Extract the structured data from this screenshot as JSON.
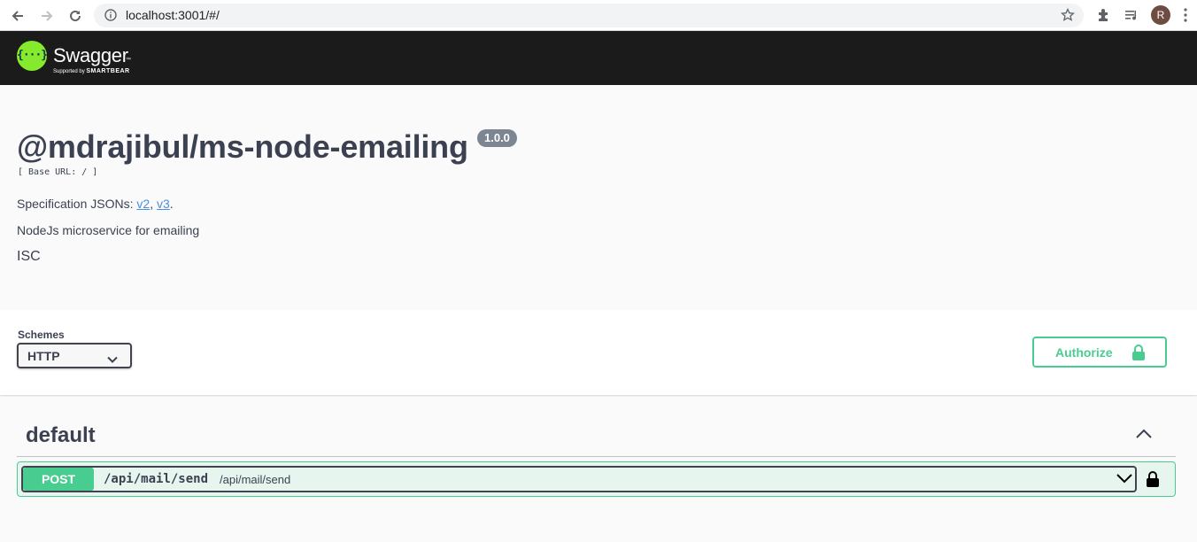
{
  "browser": {
    "url": "localhost:3001/#/",
    "avatar_letter": "R"
  },
  "topbar": {
    "logo_glyph": "{···}",
    "brand": "Swagger",
    "trademark": "™",
    "supported_by": "Supported by",
    "smartbear": "SMARTBEAR"
  },
  "info": {
    "title": "@mdrajibul/ms-node-emailing",
    "version": "1.0.0",
    "base_url": "[ Base URL: / ]",
    "spec_prefix": "Specification JSONs: ",
    "spec_v2": "v2",
    "spec_sep": ", ",
    "spec_v3": "v3",
    "spec_suffix": ".",
    "description": "NodeJs microservice for emailing",
    "license": "ISC"
  },
  "schemes": {
    "label": "Schemes",
    "selected": "HTTP"
  },
  "authorize": {
    "label": "Authorize"
  },
  "tag": {
    "name": "default"
  },
  "operations": [
    {
      "method": "POST",
      "path": "/api/mail/send",
      "summary": "/api/mail/send"
    }
  ],
  "colors": {
    "post_green": "#49cc90",
    "topbar_bg": "#1b1b1b",
    "logo_green": "#85ea2d",
    "text": "#3b4151",
    "link": "#4990e2",
    "version_badge": "#7d8492"
  }
}
